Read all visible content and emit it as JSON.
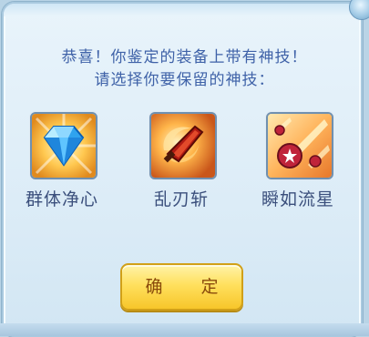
{
  "dialog": {
    "message_line1": "恭喜！你鉴定的装备上带有神技！",
    "message_line2": "请选择你要保留的神技：",
    "confirm_label": "确 定"
  },
  "skills": [
    {
      "name": "群体净心",
      "icon": "blue-diamond-icon"
    },
    {
      "name": "乱刃斩",
      "icon": "crimson-blade-icon"
    },
    {
      "name": "瞬如流星",
      "icon": "meteor-icon"
    }
  ],
  "colors": {
    "text": "#3f62a8",
    "button": "#ffe05e",
    "panel": "#e9f4fb"
  }
}
